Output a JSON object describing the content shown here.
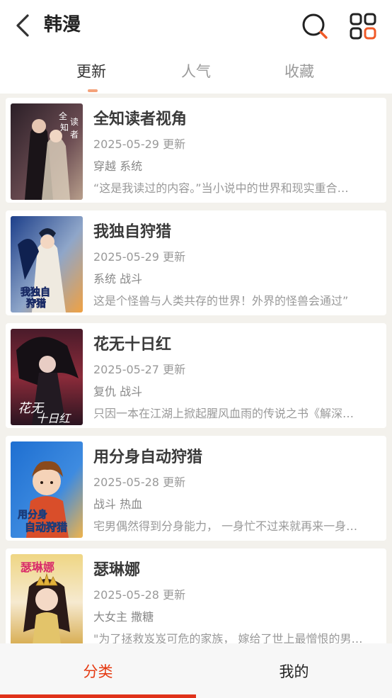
{
  "header": {
    "title": "韩漫",
    "back_icon": "chevron-left-icon",
    "search_icon": "search-icon",
    "grid_icon": "grid-apps-icon",
    "accent_color": "#f05a28"
  },
  "tabs": [
    {
      "label": "更新",
      "active": true
    },
    {
      "label": "人气",
      "active": false
    },
    {
      "label": "收藏",
      "active": false
    }
  ],
  "comics": [
    {
      "title": "全知读者视角",
      "date": "2025-05-29 更新",
      "tags": "穿越 系统",
      "desc": "“这是我读过的内容。”当小说中的世界和现实重合…",
      "cover_text": "全知读者视角",
      "cover_colors": [
        "#3b2b33",
        "#7a5a5e",
        "#c9b7a6"
      ]
    },
    {
      "title": "我独自狩猎",
      "date": "2025-05-29 更新",
      "tags": "系统 战斗",
      "desc": "这是个怪兽与人类共存的世界！外界的怪兽会通过”",
      "cover_text": "我独自狩猎",
      "cover_colors": [
        "#1d3f8a",
        "#e7e2d4",
        "#f0a142"
      ]
    },
    {
      "title": "花无十日红",
      "date": "2025-05-27 更新",
      "tags": "复仇 战斗",
      "desc": "只因一本在江湖上掀起腥风血雨的传说之书《解深…",
      "cover_text": "花无十日红",
      "cover_colors": [
        "#3a1a26",
        "#8b2b3a",
        "#d4a3a5"
      ]
    },
    {
      "title": "用分身自动狩猎",
      "date": "2025-05-28 更新",
      "tags": "战斗 热血",
      "desc": "宅男偶然得到分身能力， 一身忙不过来就再来一身…",
      "cover_text": "用分身自动狩猎",
      "cover_colors": [
        "#1d5fb7",
        "#e36b3a",
        "#f6c34a"
      ]
    },
    {
      "title": "瑟琳娜",
      "date": "2025-05-28 更新",
      "tags": "大女主 撒糖",
      "desc": "\"为了拯救岌岌可危的家族， 嫁给了世上最憎恨的男…",
      "cover_text": "瑟琳娜",
      "cover_colors": [
        "#e9cf6a",
        "#f3e3b0",
        "#c8942f"
      ]
    }
  ],
  "bottom_nav": [
    {
      "label": "分类",
      "active": true
    },
    {
      "label": "我的",
      "active": false
    }
  ]
}
